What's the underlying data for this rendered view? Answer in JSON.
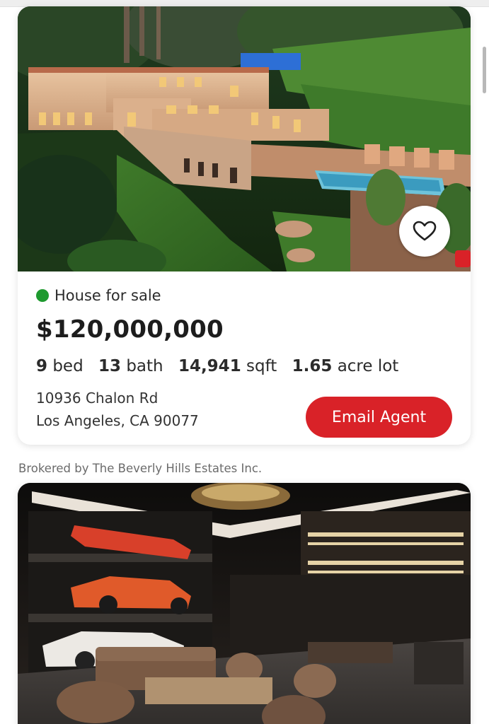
{
  "listings": [
    {
      "status": "House for sale",
      "status_color": "#1e9a2f",
      "price": "$120,000,000",
      "specs": {
        "beds_value": "9",
        "beds_label": "bed",
        "baths_value": "13",
        "baths_label": "bath",
        "sqft_value": "14,941",
        "sqft_label": "sqft",
        "lot_value": "1.65",
        "lot_label": "acre lot"
      },
      "address_line1": "10936 Chalon Rd",
      "address_line2": "Los Angeles, CA 90077",
      "cta_label": "Email Agent",
      "cta_color": "#d92228",
      "favorite_icon": "heart-outline-icon",
      "brokered_by": "Brokered by The Beverly Hills Estates Inc."
    }
  ],
  "colors": {
    "accent": "#d92228",
    "status_green": "#1e9a2f"
  }
}
